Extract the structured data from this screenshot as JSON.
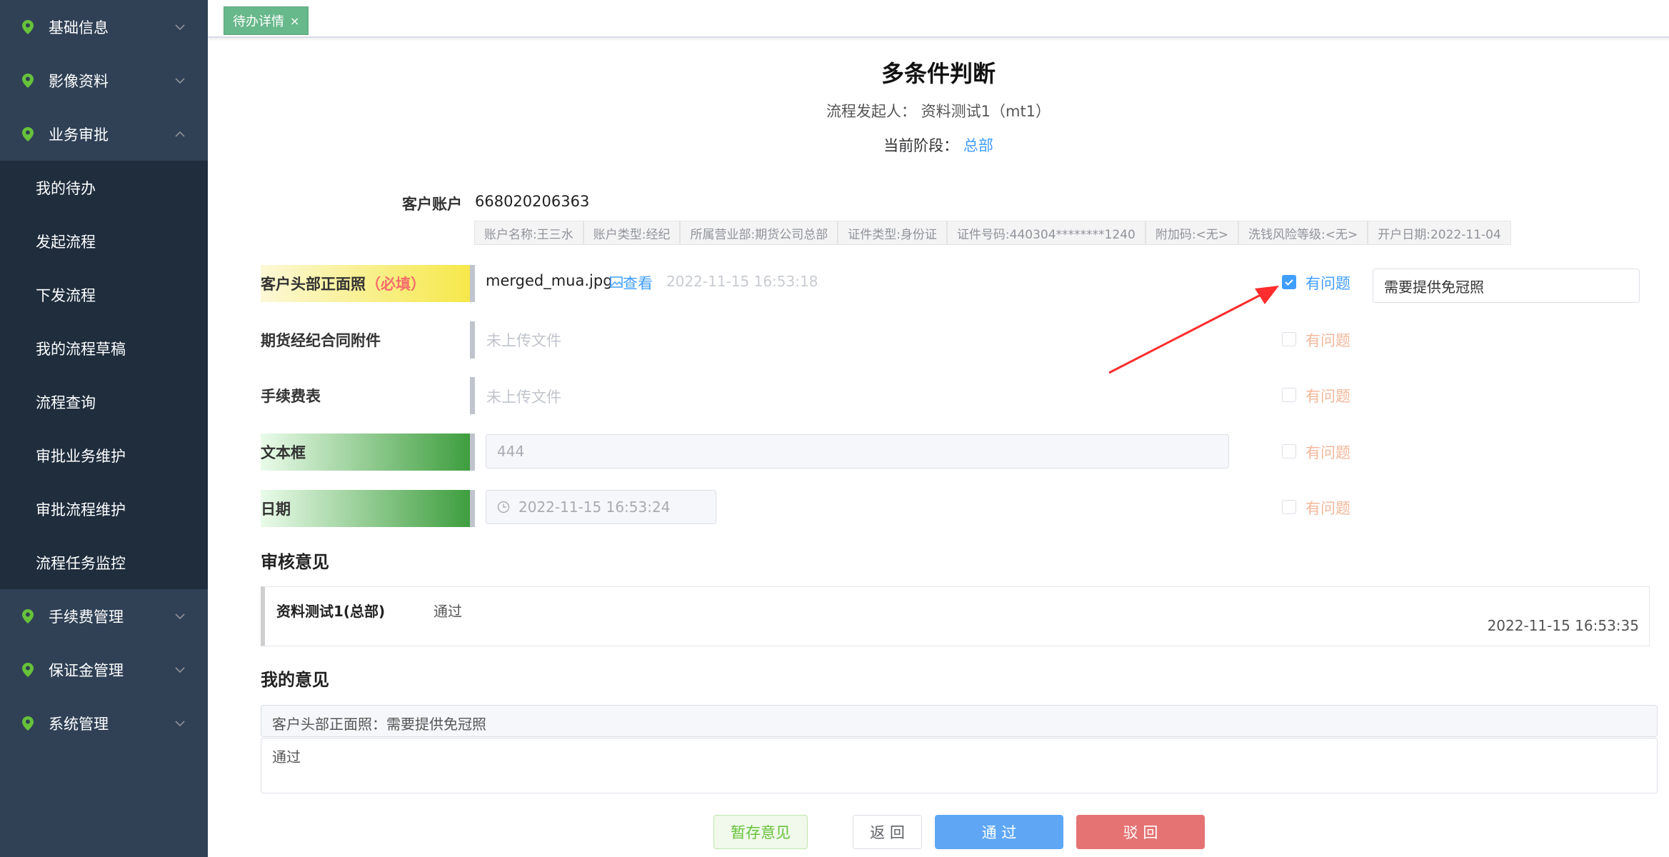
{
  "sidebar": {
    "top_items": [
      {
        "label": "基础信息"
      },
      {
        "label": "影像资料"
      },
      {
        "label": "业务审批"
      }
    ],
    "sub_items": [
      "我的待办",
      "发起流程",
      "下发流程",
      "我的流程草稿",
      "流程查询",
      "审批业务维护",
      "审批流程维护",
      "流程任务监控"
    ],
    "bottom_items": [
      {
        "label": "手续费管理"
      },
      {
        "label": "保证金管理"
      },
      {
        "label": "系统管理"
      }
    ]
  },
  "tab": {
    "label": "待办详情",
    "close": "×"
  },
  "header": {
    "title": "多条件判断",
    "initiator_label": "流程发起人：",
    "initiator_value": "资料测试1（mt1）",
    "stage_label": "当前阶段：",
    "stage_value": "总部"
  },
  "account": {
    "label": "客户账户",
    "value": "668020206363",
    "tags": [
      "账户名称:王三水",
      "账户类型:经纪",
      "所属营业部:期货公司总部",
      "证件类型:身份证",
      "证件号码:440304********1240",
      "附加码:<无>",
      "洗钱风险等级:<无>",
      "开户日期:2022-11-04"
    ]
  },
  "rows": {
    "photo": {
      "label": "客户头部正面照",
      "required": "（必填）",
      "file": "merged_mua.jpg",
      "view": "查看",
      "time": "2022-11-15 16:53:18",
      "issue": "有问题",
      "issue_checked": true,
      "issue_note": "需要提供免冠照"
    },
    "contract": {
      "label": "期货经纪合同附件",
      "empty": "未上传文件",
      "issue": "有问题"
    },
    "fee": {
      "label": "手续费表",
      "empty": "未上传文件",
      "issue": "有问题"
    },
    "textbox": {
      "label": "文本框",
      "value": "444",
      "issue": "有问题"
    },
    "date": {
      "label": "日期",
      "value": "2022-11-15 16:53:24",
      "issue": "有问题"
    }
  },
  "review": {
    "title": "审核意见",
    "entries": [
      {
        "user": "资料测试1(总部)",
        "opinion": "通过",
        "time": "2022-11-15 16:53:35"
      }
    ]
  },
  "my_opinion": {
    "title": "我的意见",
    "summary": "客户头部正面照：需要提供免冠照",
    "text": "通过"
  },
  "buttons": {
    "save": "暂存意见",
    "back": "返 回",
    "pass": "通 过",
    "reject": "驳 回"
  },
  "colors": {
    "sidebar": "#304156",
    "submenu": "#1f2d3d",
    "accent": "#409eff",
    "tab": "#67b88b",
    "danger": "#e57373",
    "pin": "#67c23a"
  }
}
